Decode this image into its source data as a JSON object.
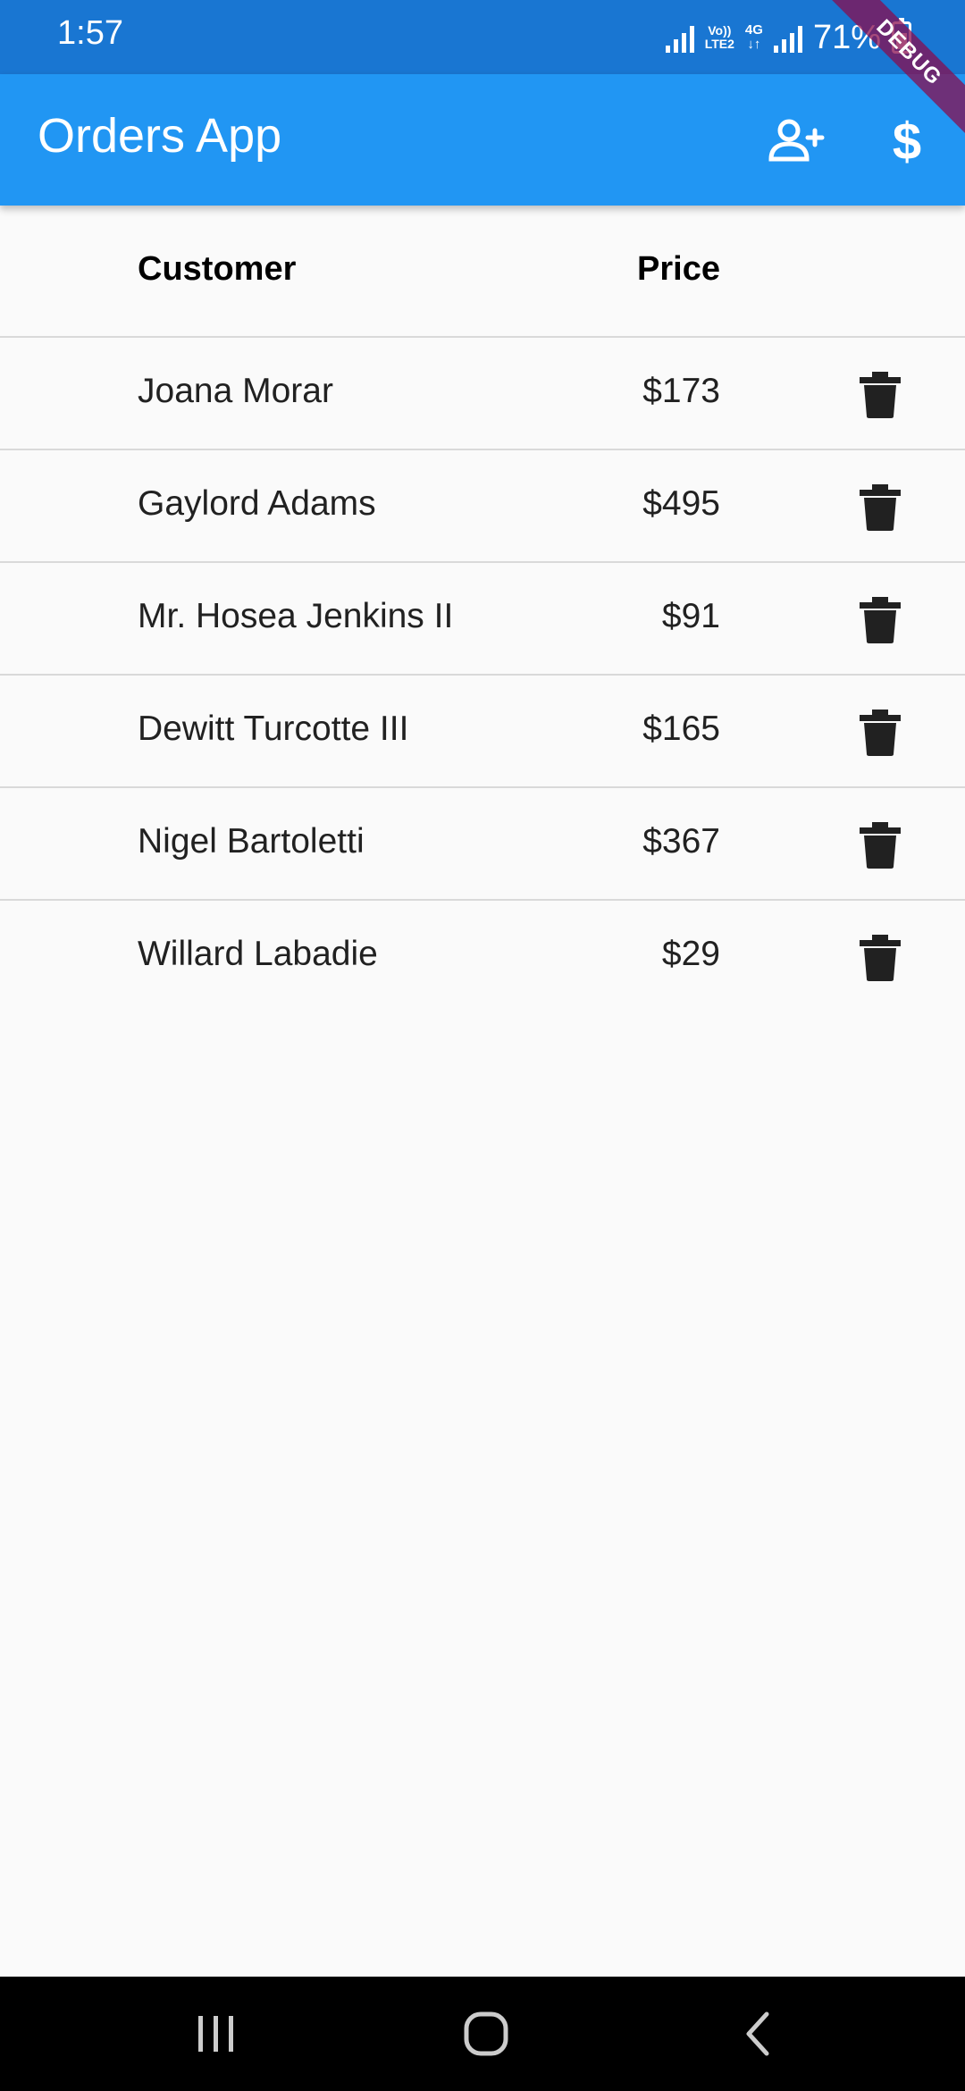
{
  "status_bar": {
    "time": "1:57",
    "volte_top": "Vo))",
    "volte_bottom": "LTE2",
    "network": "4G",
    "network_arrows": "↓↑",
    "battery": "71%"
  },
  "debug_banner": "DEBUG",
  "app_bar": {
    "title": "Orders App",
    "actions": [
      "add-user-icon",
      "dollar-icon"
    ],
    "dollar_symbol": "$",
    "color": "#2196f3"
  },
  "table": {
    "headers": {
      "customer": "Customer",
      "price": "Price"
    },
    "rows": [
      {
        "customer": "Joana Morar",
        "price": "$173"
      },
      {
        "customer": "Gaylord Adams",
        "price": "$495"
      },
      {
        "customer": "Mr. Hosea Jenkins II",
        "price": "$91"
      },
      {
        "customer": "Dewitt Turcotte III",
        "price": "$165"
      },
      {
        "customer": "Nigel Bartoletti",
        "price": "$367"
      },
      {
        "customer": "Willard Labadie",
        "price": "$29"
      }
    ],
    "row_action_icon": "trash-icon"
  },
  "nav_bar": {
    "buttons": [
      "recents-icon",
      "home-icon",
      "back-icon"
    ]
  }
}
